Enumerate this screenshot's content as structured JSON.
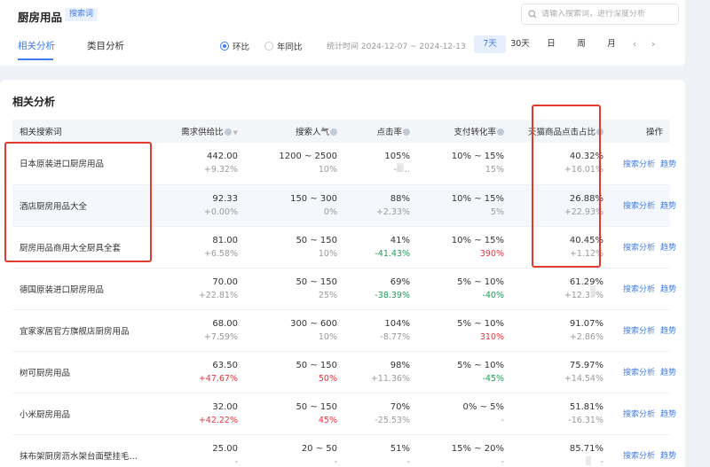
{
  "header": {
    "title": "厨房用品",
    "tag": "搜索词",
    "search_placeholder": "请输入搜索词，进行深度分析"
  },
  "tabs": [
    {
      "label": "相关分析",
      "active": true
    },
    {
      "label": "类目分析",
      "active": false
    }
  ],
  "compare": [
    {
      "label": "环比",
      "selected": true
    },
    {
      "label": "年同比",
      "selected": false
    }
  ],
  "stat_time": "统计时间 2024-12-07 ~ 2024-12-13",
  "ranges": [
    {
      "label": "7天",
      "active": true
    },
    {
      "label": "30天",
      "active": false
    },
    {
      "label": "日",
      "active": false
    },
    {
      "label": "周",
      "active": false
    },
    {
      "label": "月",
      "active": false
    }
  ],
  "pager": {
    "prev": "‹",
    "next": "›"
  },
  "section_title": "相关分析",
  "columns": {
    "keyword": "相关搜索词",
    "supply_demand": "需求供给比",
    "popularity": "搜索人气",
    "ctr": "点击率",
    "conversion": "支付转化率",
    "tmall_share": "天猫商品点击占比",
    "ops": "操作"
  },
  "op_labels": {
    "analysis": "搜索分析",
    "trend": "趋势"
  },
  "rows": [
    {
      "keyword": "日本原装进口厨房用品",
      "sd": "442.00",
      "sd_chg": "+9.32%",
      "sd_chg_color": "gray",
      "pop": "1200 ~ 2500",
      "pop_chg": "10%",
      "pop_chg_color": "gray",
      "ctr": "105%",
      "ctr_chg": "-8...",
      "ctr_chg_color": "gray",
      "conv": "10% ~ 15%",
      "conv_chg": "15%",
      "conv_chg_color": "gray",
      "share": "40.32%",
      "share_chg": "+16.01%",
      "share_chg_color": "gray",
      "highlight": false
    },
    {
      "keyword": "酒店厨房用品大全",
      "sd": "92.33",
      "sd_chg": "+0.00%",
      "sd_chg_color": "gray",
      "pop": "150 ~ 300",
      "pop_chg": "0%",
      "pop_chg_color": "gray",
      "ctr": "88%",
      "ctr_chg": "+2.33%",
      "ctr_chg_color": "gray",
      "conv": "10% ~ 15%",
      "conv_chg": "5%",
      "conv_chg_color": "gray",
      "share": "26.88%",
      "share_chg": "+22.93%",
      "share_chg_color": "gray",
      "highlight": true
    },
    {
      "keyword": "厨房用品商用大全厨具全套",
      "sd": "81.00",
      "sd_chg": "+6.58%",
      "sd_chg_color": "gray",
      "pop": "50 ~ 150",
      "pop_chg": "10%",
      "pop_chg_color": "gray",
      "ctr": "41%",
      "ctr_chg": "-41.43%",
      "ctr_chg_color": "green",
      "conv": "10% ~ 15%",
      "conv_chg": "390%",
      "conv_chg_color": "red",
      "share": "40.45%",
      "share_chg": "+1.12%",
      "share_chg_color": "gray",
      "highlight": false
    },
    {
      "keyword": "德国原装进口厨房用品",
      "sd": "70.00",
      "sd_chg": "+22.81%",
      "sd_chg_color": "gray",
      "pop": "50 ~ 150",
      "pop_chg": "25%",
      "pop_chg_color": "gray",
      "ctr": "69%",
      "ctr_chg": "-38.39%",
      "ctr_chg_color": "green",
      "conv": "5% ~ 10%",
      "conv_chg": "-40%",
      "conv_chg_color": "green",
      "share": "61.29%",
      "share_chg": "+12.37%",
      "share_chg_color": "gray",
      "highlight": false
    },
    {
      "keyword": "宜家家居官方旗舰店厨房用品",
      "sd": "68.00",
      "sd_chg": "+7.59%",
      "sd_chg_color": "gray",
      "pop": "300 ~ 600",
      "pop_chg": "10%",
      "pop_chg_color": "gray",
      "ctr": "104%",
      "ctr_chg": "-8.77%",
      "ctr_chg_color": "gray",
      "conv": "5% ~ 10%",
      "conv_chg": "310%",
      "conv_chg_color": "red",
      "share": "91.07%",
      "share_chg": "+2.86%",
      "share_chg_color": "gray",
      "highlight": false
    },
    {
      "keyword": "树可厨房用品",
      "sd": "63.50",
      "sd_chg": "+47.67%",
      "sd_chg_color": "red",
      "pop": "50 ~ 150",
      "pop_chg": "50%",
      "pop_chg_color": "red",
      "ctr": "98%",
      "ctr_chg": "+11.36%",
      "ctr_chg_color": "gray",
      "conv": "5% ~ 10%",
      "conv_chg": "-45%",
      "conv_chg_color": "green",
      "share": "75.97%",
      "share_chg": "+14.54%",
      "share_chg_color": "gray",
      "highlight": false
    },
    {
      "keyword": "小米厨房用品",
      "sd": "32.00",
      "sd_chg": "+42.22%",
      "sd_chg_color": "red",
      "pop": "50 ~ 150",
      "pop_chg": "45%",
      "pop_chg_color": "red",
      "ctr": "70%",
      "ctr_chg": "-25.53%",
      "ctr_chg_color": "gray",
      "conv": "0% ~ 5%",
      "conv_chg": "-",
      "conv_chg_color": "gray",
      "share": "51.81%",
      "share_chg": "-16.31%",
      "share_chg_color": "gray",
      "highlight": false
    },
    {
      "keyword": "抹布架厨房沥水架台面壁挂毛巾厨...",
      "sd": "25.00",
      "sd_chg": "-",
      "sd_chg_color": "gray",
      "pop": "20 ~ 50",
      "pop_chg": "-",
      "pop_chg_color": "gray",
      "ctr": "51%",
      "ctr_chg": "-",
      "ctr_chg_color": "gray",
      "conv": "15% ~ 20%",
      "conv_chg": "-",
      "conv_chg_color": "gray",
      "share": "85.71%",
      "share_chg": "-",
      "share_chg_color": "gray",
      "highlight": false
    }
  ],
  "colors": {
    "accent": "#3d7cf3",
    "red": "#f0323c",
    "green": "#1f9d55",
    "annotation_box": "#e43a2e"
  }
}
